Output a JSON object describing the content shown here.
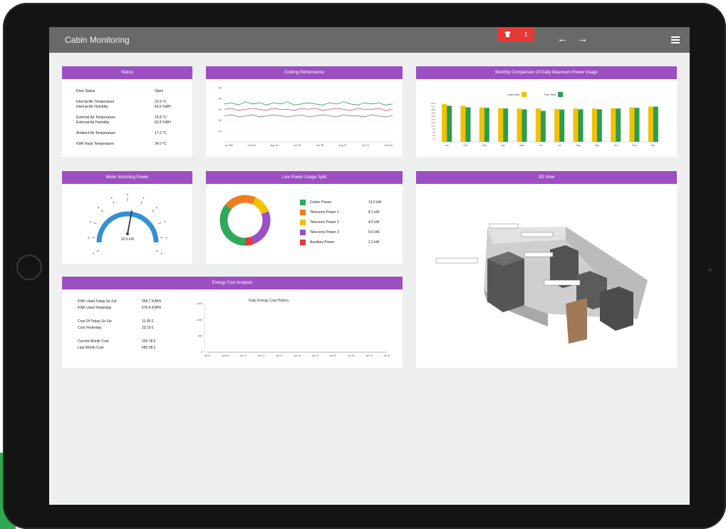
{
  "app": {
    "title": "Cabin Monitoring",
    "alarm_icon": "shirt-icon",
    "alarm_count": "1"
  },
  "nav": {
    "back": "←",
    "forward": "→",
    "menu_icon": "hamburger-icon"
  },
  "colors": {
    "accent": "#9c4fc2",
    "topbar": "#696969",
    "alarm": "#e53935",
    "series_yellow": "#f2c200",
    "series_green": "#2a9d4f"
  },
  "status": {
    "title": "Status",
    "rows": [
      {
        "label": "Door Status",
        "value": "Open"
      },
      {
        "label": "Internal Air Temperature",
        "value": "22.5 °C"
      },
      {
        "label": "Internal Air Humidity",
        "value": "43.6 %RH"
      },
      {
        "label": "External Air Temperature",
        "value": "15.8 °C"
      },
      {
        "label": "External Air Humidity",
        "value": "62.8 %RH"
      },
      {
        "label": "Ambient Air Temperature",
        "value": "17.2 °C"
      },
      {
        "label": "KWh Rack Temperature",
        "value": "34.0 °C"
      }
    ]
  },
  "cooling": {
    "title": "Cooling Performance",
    "yticks": [
      "50",
      "40",
      "30",
      "20",
      "10"
    ],
    "xticks": [
      "Jul 28d",
      "Jul 31st",
      "Aug 1st",
      "Jun 28",
      "Jun 28",
      "Aug 31",
      "Jun 31",
      "Jul 31st"
    ]
  },
  "monthly": {
    "title": "Monthly Comparison Of Daily Maximum Power Usage",
    "legend": [
      "Last Year",
      "This Year"
    ],
    "yticks": [
      "24.0",
      "22.0",
      "20.0",
      "18.0",
      "16.0",
      "14.0",
      "12.0",
      "10.0",
      "8.0",
      "6.0",
      "4.0",
      "2.0"
    ]
  },
  "meter": {
    "title": "Meter Incoming Power",
    "reading": "20.5 kW"
  },
  "live": {
    "title": "Live Power Usage Split",
    "items": [
      {
        "label": "Cooler Power",
        "value": "13.6 kW",
        "color": "#2eaa5a"
      },
      {
        "label": "Telecoms Power 1",
        "value": "8.1 kW",
        "color": "#ee7d1e"
      },
      {
        "label": "Telecoms Power 2",
        "value": "4.6 kW",
        "color": "#f2c200"
      },
      {
        "label": "Telecoms Power 3",
        "value": "9.6 kW",
        "color": "#9a4fc4"
      },
      {
        "label": "Auxiliary Power",
        "value": "2.2 kW",
        "color": "#e53935"
      }
    ]
  },
  "view3d": {
    "title": "3D View"
  },
  "energy": {
    "title": "Energy Cost Analysis",
    "rows": [
      {
        "label": "KWh Used Today So Far",
        "value": "259.7 KWHr"
      },
      {
        "label": "KWh Used Yesterday",
        "value": "576.4 KWHr"
      },
      {
        "label": "Cost Of Today So Far",
        "value": "11.09 £"
      },
      {
        "label": "Cost Yesterday",
        "value": "23.10 £"
      },
      {
        "label": "Current Month Cost",
        "value": "235.78 £"
      },
      {
        "label": "Last Month Cost",
        "value": "685.28 £"
      }
    ],
    "chart_title": "Daily Energy Cost History",
    "yticks": [
      "1,500",
      "1,000",
      "500",
      "0"
    ]
  },
  "chart_data": [
    {
      "type": "line",
      "title": "Cooling Performance",
      "ylim": [
        0,
        50
      ],
      "series": [
        {
          "color": "#2e9e6a",
          "values": [
            35,
            36,
            34,
            37,
            35,
            36,
            34,
            36,
            35,
            37,
            34,
            35,
            36,
            35,
            34,
            36,
            35,
            37,
            35,
            34,
            36,
            35,
            36,
            34,
            35
          ]
        },
        {
          "color": "#d9477e",
          "values": [
            30,
            31,
            29,
            30,
            31,
            30,
            29,
            31,
            30,
            30,
            29,
            31,
            30,
            31,
            29,
            30,
            31,
            30,
            29,
            31,
            30,
            30,
            31,
            29,
            30
          ]
        },
        {
          "color": "#4a8a4a",
          "values": [
            24,
            25,
            23,
            24,
            25,
            23,
            24,
            25,
            24,
            23,
            24,
            25,
            23,
            24,
            25,
            24,
            23,
            25,
            24,
            24,
            23,
            25,
            24,
            23,
            24
          ]
        }
      ]
    },
    {
      "type": "bar",
      "title": "Monthly Comparison Of Daily Maximum Power Usage",
      "categories": [
        "Jan",
        "Feb",
        "Mar",
        "Apr",
        "May",
        "Jun",
        "Jul",
        "Aug",
        "Sep",
        "Oct",
        "Nov",
        "Dec"
      ],
      "ylim": [
        0,
        24
      ],
      "series": [
        {
          "name": "Last Year",
          "values": [
            23.5,
            22.5,
            21.5,
            21.0,
            20.8,
            20.8,
            20.5,
            20.8,
            20.8,
            21.0,
            21.5,
            22.0
          ]
        },
        {
          "name": "This Year",
          "values": [
            22.5,
            21.5,
            21.2,
            20.8,
            20.3,
            19.3,
            20.2,
            20.3,
            20.3,
            20.8,
            21.2,
            22.0
          ]
        }
      ]
    },
    {
      "type": "line",
      "title": "Daily Energy Cost History",
      "ylim": [
        0,
        1500
      ],
      "xticks": [
        "Jan 01",
        "Jan 04",
        "Jan 07",
        "Jan 10",
        "Jan 13",
        "Jan 16",
        "Jan 19",
        "Jan 22",
        "Jan 25",
        "Jan 28",
        "Jan 31"
      ],
      "series": [
        {
          "values": [
            0,
            0,
            0,
            0,
            0,
            0,
            0,
            0,
            0,
            0,
            0
          ]
        }
      ]
    }
  ]
}
